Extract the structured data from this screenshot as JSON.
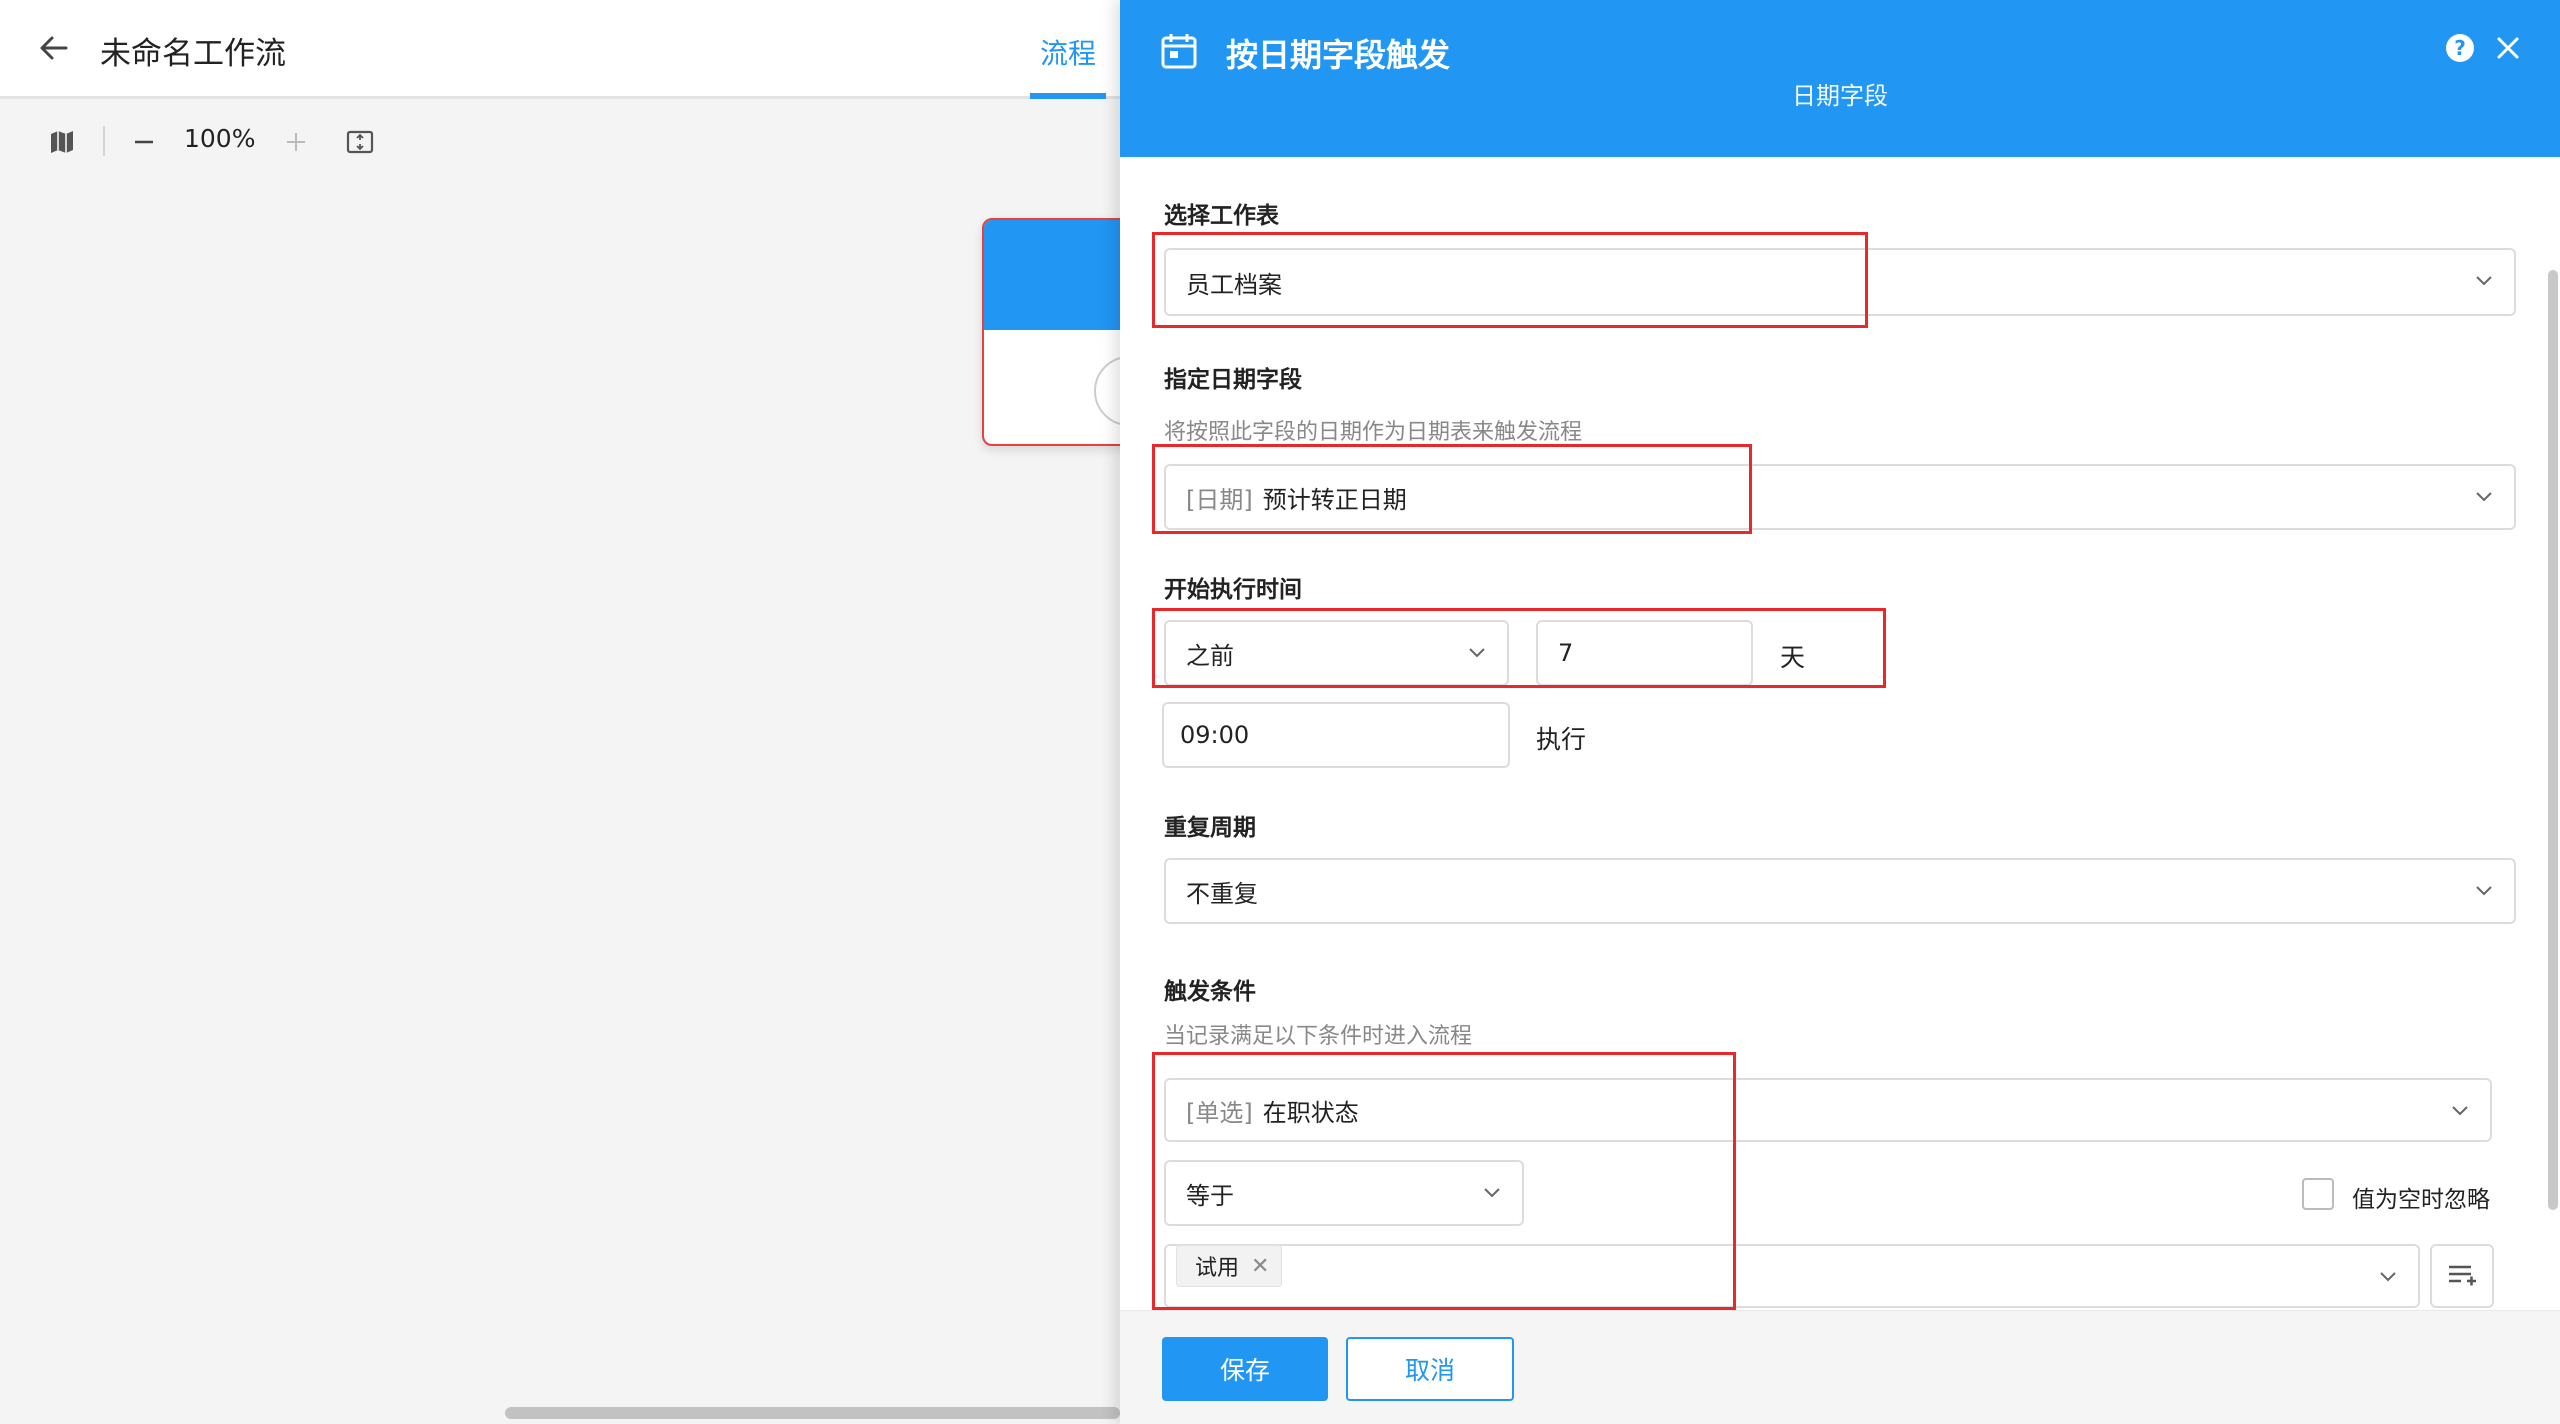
{
  "workflow": {
    "title": "未命名工作流",
    "tab_flow": "流程",
    "zoom": "100%"
  },
  "panel": {
    "title": "按日期字段触发",
    "subtitle": "日期字段",
    "help": "?",
    "sheet": {
      "label": "选择工作表",
      "value": "员工档案"
    },
    "date_field": {
      "label": "指定日期字段",
      "hint": "将按照此字段的日期作为日期表来触发流程",
      "prefix": "[日期]",
      "value": "预计转正日期"
    },
    "start_time": {
      "label": "开始执行时间",
      "relation": "之前",
      "offset": "7",
      "unit": "天",
      "time": "09:00",
      "suffix": "执行"
    },
    "repeat": {
      "label": "重复周期",
      "value": "不重复"
    },
    "trigger": {
      "label": "触发条件",
      "hint": "当记录满足以下条件时进入流程",
      "field_prefix": "[单选]",
      "field_value": "在职状态",
      "operator": "等于",
      "ignore_empty": "值为空时忽略",
      "tag": "试用"
    },
    "save": "保存",
    "cancel": "取消"
  },
  "colors": {
    "primary": "#2196f3",
    "highlight": "#e8292b"
  }
}
